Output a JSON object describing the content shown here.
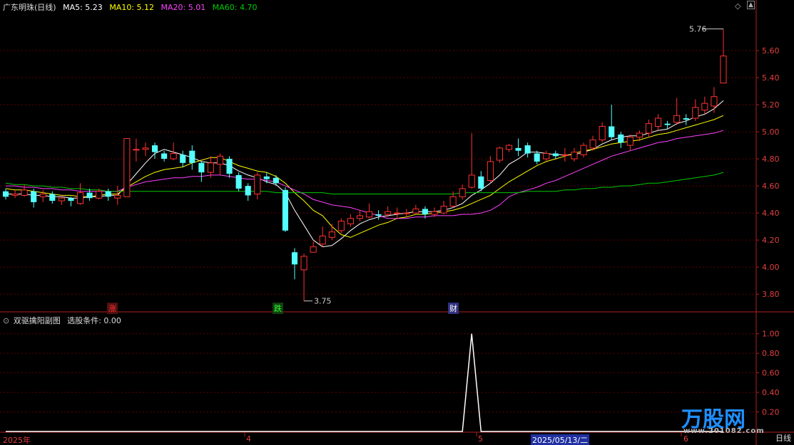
{
  "main_header": {
    "title": "广东明珠(日线)",
    "ma": [
      {
        "label": "MA5: 5.23",
        "color": "#ffffff"
      },
      {
        "label": "MA10: 5.12",
        "color": "#ffff00"
      },
      {
        "label": "MA20: 5.01",
        "color": "#ff40ff"
      },
      {
        "label": "MA60: 4.70",
        "color": "#00cc00"
      }
    ]
  },
  "sub_header": {
    "title": "双驱擒阳副图",
    "condition": "选股条件: 0.00"
  },
  "markers": {
    "zhang": "涨",
    "die": "跌",
    "cai": "财"
  },
  "x_labels": [
    "2025年",
    "4",
    "5",
    "2025/05/13/二",
    "6"
  ],
  "period_label": "日线",
  "watermark": {
    "brand": "万股网",
    "url": "www.201082.com"
  },
  "chart_data": [
    {
      "type": "candlestick",
      "ylim": [
        3.68,
        5.9
      ],
      "y_ticks": [
        3.8,
        4.0,
        4.2,
        4.4,
        4.6,
        4.8,
        5.0,
        5.2,
        5.4,
        5.6
      ],
      "annotations": {
        "high_label": "5.76",
        "low_label": "3.75"
      },
      "candles": [
        [
          4.56,
          4.52,
          4.58,
          4.5
        ],
        [
          4.53,
          4.54,
          4.57,
          4.51
        ],
        [
          4.53,
          4.57,
          4.61,
          4.52
        ],
        [
          4.56,
          4.48,
          4.58,
          4.44
        ],
        [
          4.52,
          4.54,
          4.57,
          4.48
        ],
        [
          4.54,
          4.49,
          4.56,
          4.47
        ],
        [
          4.49,
          4.51,
          4.53,
          4.46
        ],
        [
          4.51,
          4.49,
          4.52,
          4.45
        ],
        [
          4.47,
          4.55,
          4.62,
          4.46
        ],
        [
          4.55,
          4.51,
          4.58,
          4.49
        ],
        [
          4.51,
          4.56,
          4.58,
          4.5
        ],
        [
          4.56,
          4.52,
          4.58,
          4.49
        ],
        [
          4.51,
          4.53,
          4.6,
          4.46
        ],
        [
          4.52,
          4.95,
          4.95,
          4.52
        ],
        [
          4.87,
          4.87,
          4.95,
          4.78
        ],
        [
          4.87,
          4.88,
          4.92,
          4.82
        ],
        [
          4.9,
          4.85,
          4.92,
          4.8
        ],
        [
          4.84,
          4.8,
          4.86,
          4.78
        ],
        [
          4.8,
          4.84,
          4.92,
          4.79
        ],
        [
          4.83,
          4.77,
          4.86,
          4.74
        ],
        [
          4.86,
          4.77,
          4.9,
          4.72
        ],
        [
          4.77,
          4.7,
          4.78,
          4.63
        ],
        [
          4.7,
          4.77,
          4.82,
          4.66
        ],
        [
          4.76,
          4.82,
          4.84,
          4.68
        ],
        [
          4.8,
          4.69,
          4.82,
          4.66
        ],
        [
          4.68,
          4.58,
          4.7,
          4.56
        ],
        [
          4.6,
          4.53,
          4.62,
          4.49
        ],
        [
          4.54,
          4.68,
          4.7,
          4.5
        ],
        [
          4.67,
          4.65,
          4.7,
          4.62
        ],
        [
          4.66,
          4.62,
          4.68,
          4.6
        ],
        [
          4.57,
          4.27,
          4.59,
          4.26
        ],
        [
          4.11,
          4.02,
          4.14,
          3.91
        ],
        [
          3.98,
          4.08,
          4.1,
          3.75
        ],
        [
          4.11,
          4.15,
          4.19,
          4.12
        ],
        [
          4.17,
          4.23,
          4.3,
          4.15
        ],
        [
          4.22,
          4.26,
          4.32,
          4.2
        ],
        [
          4.27,
          4.34,
          4.36,
          4.25
        ],
        [
          4.32,
          4.36,
          4.39,
          4.3
        ],
        [
          4.36,
          4.38,
          4.42,
          4.34
        ],
        [
          4.37,
          4.41,
          4.47,
          4.36
        ],
        [
          4.39,
          4.38,
          4.42,
          4.35
        ],
        [
          4.39,
          4.41,
          4.45,
          4.37
        ],
        [
          4.4,
          4.4,
          4.44,
          4.36
        ],
        [
          4.4,
          4.4,
          4.43,
          4.37
        ],
        [
          4.4,
          4.43,
          4.46,
          4.39
        ],
        [
          4.43,
          4.39,
          4.45,
          4.36
        ],
        [
          4.39,
          4.41,
          4.44,
          4.37
        ],
        [
          4.4,
          4.45,
          4.49,
          4.39
        ],
        [
          4.45,
          4.52,
          4.56,
          4.44
        ],
        [
          4.52,
          4.58,
          4.61,
          4.5
        ],
        [
          4.59,
          4.68,
          4.99,
          4.58
        ],
        [
          4.67,
          4.58,
          4.71,
          4.56
        ],
        [
          4.64,
          4.78,
          4.82,
          4.62
        ],
        [
          4.79,
          4.88,
          4.89,
          4.77
        ],
        [
          4.87,
          4.9,
          4.91,
          4.85
        ],
        [
          4.88,
          4.86,
          4.95,
          4.82
        ],
        [
          4.9,
          4.84,
          4.92,
          4.81
        ],
        [
          4.84,
          4.78,
          4.86,
          4.76
        ],
        [
          4.8,
          4.84,
          4.86,
          4.78
        ],
        [
          4.84,
          4.82,
          4.86,
          4.8
        ],
        [
          4.83,
          4.83,
          4.88,
          4.78
        ],
        [
          4.8,
          4.85,
          4.88,
          4.78
        ],
        [
          4.83,
          4.9,
          4.92,
          4.81
        ],
        [
          4.88,
          4.94,
          4.97,
          4.86
        ],
        [
          4.94,
          5.04,
          5.07,
          4.92
        ],
        [
          5.04,
          4.96,
          5.2,
          4.94
        ],
        [
          4.98,
          4.92,
          5.0,
          4.88
        ],
        [
          4.9,
          4.96,
          4.98,
          4.86
        ],
        [
          4.96,
          4.99,
          5.01,
          4.93
        ],
        [
          4.99,
          5.06,
          5.09,
          4.96
        ],
        [
          5.04,
          5.1,
          5.13,
          5.01
        ],
        [
          5.06,
          5.05,
          5.08,
          5.02
        ],
        [
          5.07,
          5.12,
          5.25,
          5.05
        ],
        [
          5.1,
          5.09,
          5.13,
          5.05
        ],
        [
          5.1,
          5.18,
          5.24,
          5.08
        ],
        [
          5.16,
          5.21,
          5.26,
          5.13
        ],
        [
          5.19,
          5.26,
          5.33,
          5.14
        ],
        [
          5.36,
          5.56,
          5.76,
          5.36
        ]
      ],
      "ma_lines": {
        "MA5": [
          4.54,
          4.54,
          4.54,
          4.53,
          4.53,
          4.52,
          4.52,
          4.51,
          4.51,
          4.52,
          4.52,
          4.53,
          4.53,
          4.61,
          4.69,
          4.77,
          4.84,
          4.87,
          4.85,
          4.83,
          4.81,
          4.78,
          4.77,
          4.77,
          4.75,
          4.71,
          4.68,
          4.66,
          4.63,
          4.61,
          4.55,
          4.42,
          4.31,
          4.2,
          4.15,
          4.16,
          4.21,
          4.27,
          4.32,
          4.35,
          4.37,
          4.38,
          4.39,
          4.4,
          4.41,
          4.41,
          4.41,
          4.42,
          4.44,
          4.47,
          4.53,
          4.57,
          4.62,
          4.68,
          4.76,
          4.8,
          4.85,
          4.85,
          4.84,
          4.83,
          4.83,
          4.83,
          4.85,
          4.87,
          4.91,
          4.94,
          4.96,
          4.97,
          4.97,
          4.99,
          5.01,
          5.02,
          5.06,
          5.08,
          5.11,
          5.13,
          5.17,
          5.23
        ],
        "MA10": [
          4.58,
          4.57,
          4.57,
          4.56,
          4.55,
          4.54,
          4.53,
          4.53,
          4.52,
          4.52,
          4.53,
          4.54,
          4.54,
          4.59,
          4.63,
          4.67,
          4.7,
          4.72,
          4.73,
          4.74,
          4.77,
          4.79,
          4.81,
          4.81,
          4.78,
          4.75,
          4.73,
          4.71,
          4.7,
          4.67,
          4.62,
          4.55,
          4.49,
          4.42,
          4.38,
          4.3,
          4.24,
          4.22,
          4.25,
          4.28,
          4.31,
          4.33,
          4.36,
          4.37,
          4.39,
          4.39,
          4.4,
          4.41,
          4.42,
          4.44,
          4.47,
          4.5,
          4.53,
          4.58,
          4.63,
          4.67,
          4.71,
          4.75,
          4.78,
          4.8,
          4.82,
          4.84,
          4.86,
          4.87,
          4.89,
          4.91,
          4.92,
          4.93,
          4.94,
          4.96,
          4.98,
          4.99,
          5.01,
          5.03,
          5.05,
          5.07,
          5.09,
          5.12
        ],
        "MA20": [
          4.6,
          4.6,
          4.59,
          4.59,
          4.58,
          4.58,
          4.57,
          4.57,
          4.56,
          4.56,
          4.56,
          4.56,
          4.56,
          4.59,
          4.61,
          4.63,
          4.64,
          4.65,
          4.66,
          4.66,
          4.67,
          4.67,
          4.68,
          4.68,
          4.67,
          4.66,
          4.65,
          4.65,
          4.64,
          4.63,
          4.6,
          4.57,
          4.54,
          4.5,
          4.48,
          4.46,
          4.45,
          4.44,
          4.42,
          4.4,
          4.38,
          4.36,
          4.36,
          4.36,
          4.37,
          4.37,
          4.38,
          4.38,
          4.38,
          4.39,
          4.39,
          4.4,
          4.42,
          4.46,
          4.52,
          4.55,
          4.57,
          4.59,
          4.62,
          4.64,
          4.67,
          4.7,
          4.73,
          4.76,
          4.79,
          4.82,
          4.84,
          4.86,
          4.88,
          4.9,
          4.92,
          4.93,
          4.95,
          4.96,
          4.97,
          4.98,
          4.99,
          5.01
        ],
        "MA60": [
          4.62,
          4.61,
          4.61,
          4.6,
          4.6,
          4.59,
          4.59,
          4.58,
          4.58,
          4.57,
          4.57,
          4.56,
          4.56,
          4.56,
          4.56,
          4.56,
          4.56,
          4.56,
          4.56,
          4.56,
          4.56,
          4.56,
          4.56,
          4.56,
          4.56,
          4.56,
          4.56,
          4.56,
          4.56,
          4.55,
          4.55,
          4.55,
          4.55,
          4.55,
          4.55,
          4.54,
          4.54,
          4.54,
          4.54,
          4.54,
          4.54,
          4.54,
          4.54,
          4.54,
          4.54,
          4.54,
          4.54,
          4.54,
          4.54,
          4.55,
          4.55,
          4.55,
          4.55,
          4.55,
          4.55,
          4.55,
          4.56,
          4.56,
          4.56,
          4.56,
          4.57,
          4.57,
          4.58,
          4.58,
          4.59,
          4.59,
          4.6,
          4.6,
          4.61,
          4.62,
          4.62,
          4.63,
          4.64,
          4.65,
          4.66,
          4.67,
          4.68,
          4.7
        ]
      }
    },
    {
      "type": "line",
      "ylim": [
        0,
        1.1
      ],
      "y_ticks": [
        0.2,
        0.4,
        0.6,
        0.8,
        1.0
      ],
      "values": [
        0,
        0,
        0,
        0,
        0,
        0,
        0,
        0,
        0,
        0,
        0,
        0,
        0,
        0,
        0,
        0,
        0,
        0,
        0,
        0,
        0,
        0,
        0,
        0,
        0,
        0,
        0,
        0,
        0,
        0,
        0,
        0,
        0,
        0,
        0,
        0,
        0,
        0,
        0,
        0,
        0,
        0,
        0,
        0,
        0,
        0,
        0,
        0,
        0,
        0,
        1,
        0,
        0,
        0,
        0,
        0,
        0,
        0,
        0,
        0,
        0,
        0,
        0,
        0,
        0,
        0,
        0,
        0,
        0,
        0,
        0,
        0,
        0,
        0,
        0,
        0,
        0,
        0
      ]
    }
  ]
}
